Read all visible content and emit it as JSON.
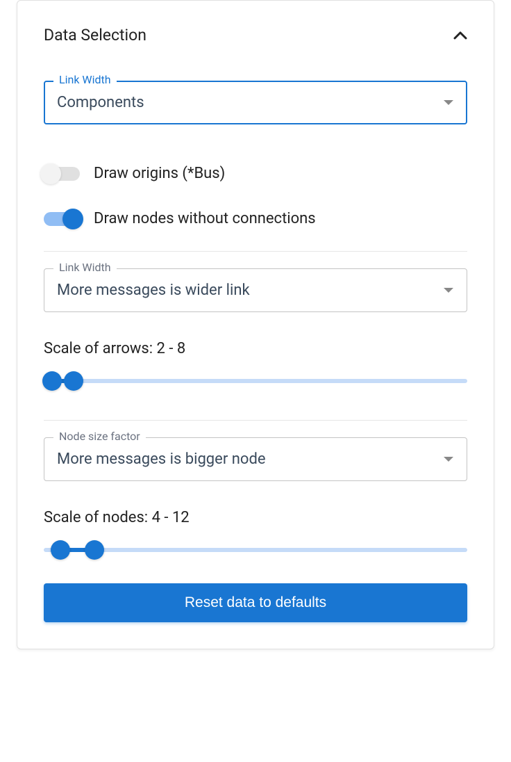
{
  "panel": {
    "title": "Data Selection"
  },
  "select1": {
    "label": "Link Width",
    "value": "Components"
  },
  "toggle1": {
    "label": "Draw origins (*Bus)",
    "on": false
  },
  "toggle2": {
    "label": "Draw nodes without connections",
    "on": true
  },
  "select2": {
    "label": "Link Width",
    "value": "More messages is wider link"
  },
  "slider1": {
    "label": "Scale of arrows: 2 - 8",
    "min": 2,
    "max": 8,
    "range_min_value": 2,
    "range_max_value": 8,
    "thumb1_pct": 2,
    "thumb2_pct": 7
  },
  "select3": {
    "label": "Node size factor",
    "value": "More messages is bigger node"
  },
  "slider2": {
    "label": "Scale of nodes: 4 - 12",
    "min": 4,
    "max": 12,
    "range_min_value": 4,
    "range_max_value": 12,
    "thumb1_pct": 4,
    "thumb2_pct": 12
  },
  "reset_button": "Reset data to defaults"
}
